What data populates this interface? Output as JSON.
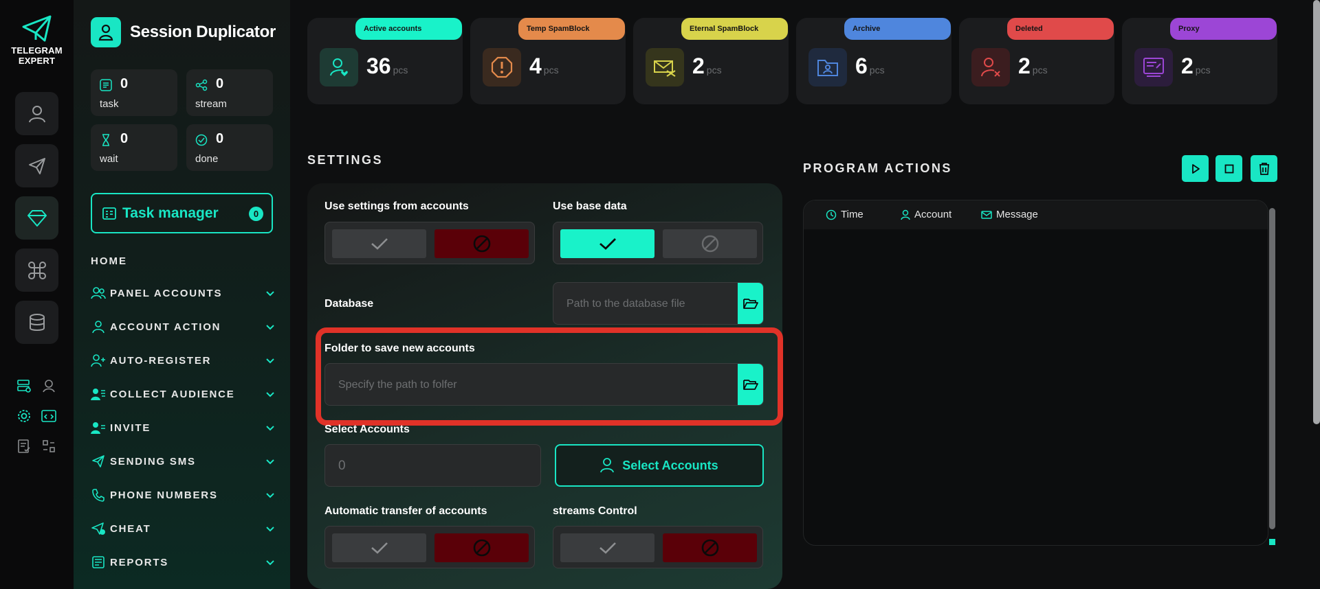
{
  "brand": {
    "name": "TELEGRAM EXPERT"
  },
  "app": {
    "title": "Session Duplicator"
  },
  "stats": [
    {
      "value": "0",
      "label": "task"
    },
    {
      "value": "0",
      "label": "stream"
    },
    {
      "value": "0",
      "label": "wait"
    },
    {
      "value": "0",
      "label": "done"
    }
  ],
  "task_manager": {
    "label": "Task manager",
    "count": "0"
  },
  "nav": {
    "home": "HOME",
    "items": [
      "PANEL ACCOUNTS",
      "ACCOUNT ACTION",
      "AUTO-REGISTER",
      "COLLECT AUDIENCE",
      "INVITE",
      "SENDING SMS",
      "PHONE NUMBERS",
      "CHEAT",
      "REPORTS"
    ]
  },
  "cards": [
    {
      "tag": "Active accounts",
      "value": "36",
      "unit": "pcs",
      "color": "#19f2c9"
    },
    {
      "tag": "Temp SpamBlock",
      "value": "4",
      "unit": "pcs",
      "color": "#e48a4b"
    },
    {
      "tag": "Eternal SpamBlock",
      "value": "2",
      "unit": "pcs",
      "color": "#d8d34b"
    },
    {
      "tag": "Archive",
      "value": "6",
      "unit": "pcs",
      "color": "#4f86dd"
    },
    {
      "tag": "Deleted",
      "value": "2",
      "unit": "pcs",
      "color": "#e04a4a"
    },
    {
      "tag": "Proxy",
      "value": "2",
      "unit": "pcs",
      "color": "#9c46d6"
    }
  ],
  "settings": {
    "title": "SETTINGS",
    "use_settings_label": "Use settings from accounts",
    "use_base_label": "Use base data",
    "database_label": "Database",
    "database_placeholder": "Path to the database file",
    "folder_label": "Folder to save new accounts",
    "folder_placeholder": "Specify the path to folfer",
    "select_accounts_label": "Select Accounts",
    "select_accounts_count": "0",
    "select_accounts_button": "Select Accounts",
    "auto_transfer_label": "Automatic transfer of accounts",
    "streams_label": "streams Control"
  },
  "actions": {
    "title": "PROGRAM ACTIONS",
    "columns": [
      "Time",
      "Account",
      "Message"
    ]
  }
}
